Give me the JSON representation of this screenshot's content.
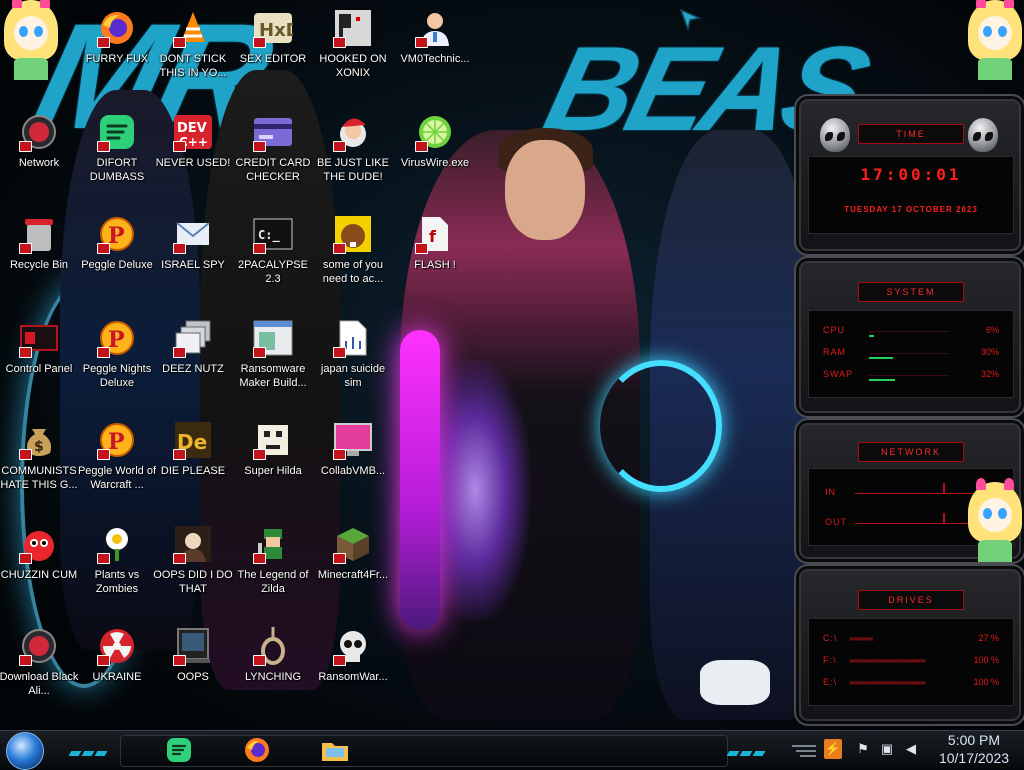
{
  "desktop": {
    "icons": [
      {
        "label": "FURRY FUX",
        "icon": "firefox-icon"
      },
      {
        "label": "DONT STICK THIS IN YO...",
        "icon": "vlc-cone-icon"
      },
      {
        "label": "SEX EDITOR",
        "icon": "hex-editor-icon"
      },
      {
        "label": "HOOKED ON XONIX",
        "icon": "xonix-game-icon"
      },
      {
        "label": "VM0Technic...",
        "icon": "doctor-person-icon"
      },
      {
        "label": "Network",
        "icon": "network-orb-icon"
      },
      {
        "label": "DIFORT DUMBASS",
        "icon": "spotify-like-icon"
      },
      {
        "label": "NEVER USED!",
        "icon": "dev-cpp-icon"
      },
      {
        "label": "CREDIT CARD CHECKER",
        "icon": "credit-card-icon"
      },
      {
        "label": "BE JUST LIKE THE DUDE!",
        "icon": "santa-icon"
      },
      {
        "label": "VirusWire.exe",
        "icon": "lime-icon"
      },
      {
        "label": "Recycle Bin",
        "icon": "recycle-bin-icon"
      },
      {
        "label": "Peggle Deluxe",
        "icon": "peggle-icon"
      },
      {
        "label": "ISRAEL SPY",
        "icon": "mail-icon"
      },
      {
        "label": "2PACALYPSE 2.3",
        "icon": "terminal-icon"
      },
      {
        "label": "some of you need to ac...",
        "icon": "beaver-icon"
      },
      {
        "label": "FLASH !",
        "icon": "flash-file-icon"
      },
      {
        "label": "Control Panel",
        "icon": "control-panel-icon"
      },
      {
        "label": "Peggle Nights Deluxe",
        "icon": "peggle-icon"
      },
      {
        "label": "DEEZ NUTZ",
        "icon": "windows-stack-icon"
      },
      {
        "label": "Ransomware Maker Build...",
        "icon": "app-window-icon"
      },
      {
        "label": "japan suicide sim",
        "icon": "document-icon"
      },
      {
        "label": "COMMUNISTS HATE THIS G...",
        "icon": "money-bag-icon"
      },
      {
        "label": "Peggle World of Warcraft ...",
        "icon": "peggle-icon"
      },
      {
        "label": "DIE PLEASE",
        "icon": "adobe-de-icon"
      },
      {
        "label": "Super Hilda",
        "icon": "pixel-sprite-icon"
      },
      {
        "label": "CollabVMB...",
        "icon": "monitor-icon"
      },
      {
        "label": "CHUZZIN CUM",
        "icon": "chuzzle-icon"
      },
      {
        "label": "Plants vs Zombies",
        "icon": "flower-icon"
      },
      {
        "label": "OOPS DID I DO THAT",
        "icon": "portrait-icon"
      },
      {
        "label": "The Legend of Zilda",
        "icon": "pixel-hero-icon"
      },
      {
        "label": "Minecraft4Fr...",
        "icon": "minecraft-block-icon"
      },
      {
        "label": "Download Black Ali...",
        "icon": "alien-orb-icon"
      },
      {
        "label": "UKRAINE",
        "icon": "radiation-icon"
      },
      {
        "label": "OOPS",
        "icon": "dark-window-icon"
      },
      {
        "label": "LYNCHING",
        "icon": "noose-icon"
      },
      {
        "label": "RansomWar...",
        "icon": "skull-icon"
      }
    ]
  },
  "widgets": {
    "time": {
      "title": "TIME",
      "clock": "17:00:01",
      "date": "TUESDAY 17 OCTOBER 2023"
    },
    "system": {
      "title": "SYSTEM",
      "rows": [
        {
          "label": "CPU",
          "value": "6%",
          "level": 0.06
        },
        {
          "label": "RAM",
          "value": "30%",
          "level": 0.3
        },
        {
          "label": "SWAP",
          "value": "32%",
          "level": 0.32
        }
      ]
    },
    "network": {
      "title": "NETWORK",
      "in_label": "IN",
      "out_label": "OUT"
    },
    "drives": {
      "title": "DRIVES",
      "rows": [
        {
          "label": "C:\\",
          "value": "27 %",
          "level": 0.27
        },
        {
          "label": "F:\\",
          "value": "100 %",
          "level": 1.0
        },
        {
          "label": "E:\\",
          "value": "100 %",
          "level": 1.0
        }
      ]
    }
  },
  "taskbar": {
    "pinned": [
      "spotify-like-icon",
      "firefox-icon",
      "file-explorer-icon"
    ],
    "tray": [
      "keyboard-icon",
      "flag-icon",
      "network-icon",
      "speaker-icon"
    ],
    "time": "5:00 PM",
    "date": "10/17/2023"
  },
  "colors": {
    "accent_red": "#e11c1c",
    "accent_cyan": "#1fa3c9",
    "bar_green": "#23d15a"
  }
}
